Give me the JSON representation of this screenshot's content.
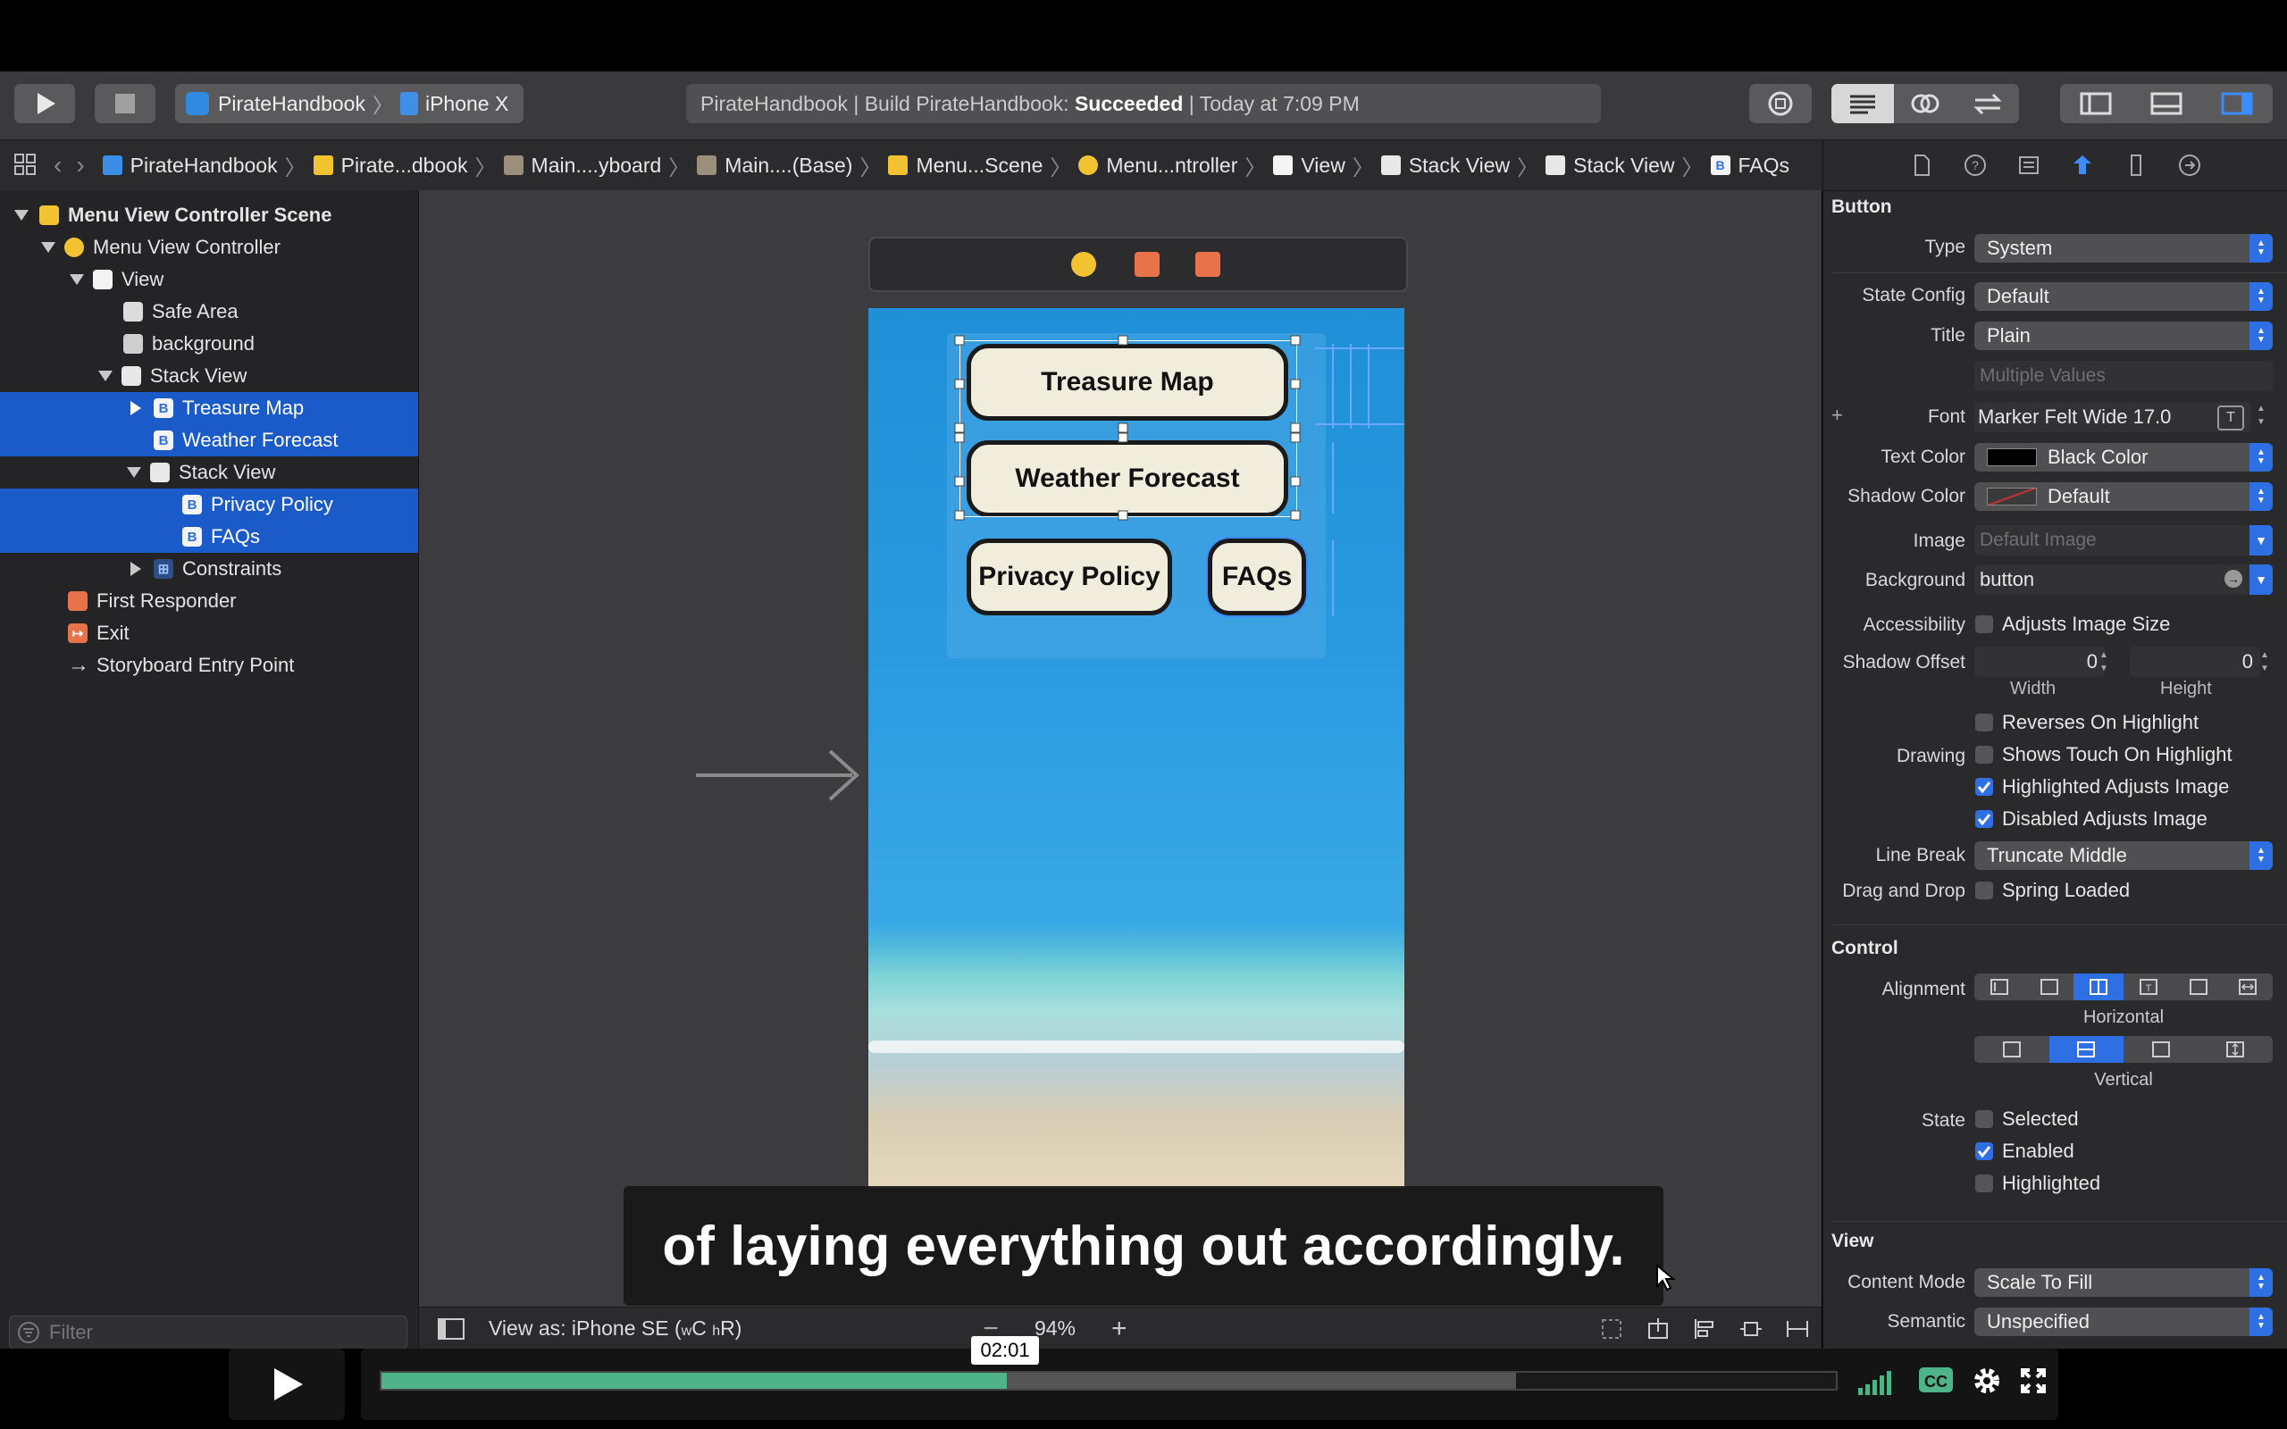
{
  "toolbar": {
    "scheme_app": "PirateHandbook",
    "scheme_device": "iPhone X",
    "status_prefix": "PirateHandbook | Build PirateHandbook: ",
    "status_result": "Succeeded",
    "status_suffix": " | Today at 7:09 PM"
  },
  "breadcrumbs": [
    "PirateHandbook",
    "Pirate...dbook",
    "Main....yboard",
    "Main....(Base)",
    "Menu...Scene",
    "Menu...ntroller",
    "View",
    "Stack View",
    "Stack View",
    "FAQs"
  ],
  "navigator": {
    "rows": [
      {
        "label": "Menu View Controller Scene",
        "icon": "scene-icon"
      },
      {
        "label": "Menu View Controller",
        "icon": "view-controller-icon"
      },
      {
        "label": "View",
        "icon": "view-icon"
      },
      {
        "label": "Safe Area",
        "icon": "safe-area-icon"
      },
      {
        "label": "background",
        "icon": "image-view-icon"
      },
      {
        "label": "Stack View",
        "icon": "stack-view-icon"
      },
      {
        "label": "Treasure Map",
        "icon": "button-icon"
      },
      {
        "label": "Weather Forecast",
        "icon": "button-icon"
      },
      {
        "label": "Stack View",
        "icon": "stack-view-icon"
      },
      {
        "label": "Privacy Policy",
        "icon": "button-icon"
      },
      {
        "label": "FAQs",
        "icon": "button-icon"
      },
      {
        "label": "Constraints",
        "icon": "constraints-icon"
      },
      {
        "label": "First Responder",
        "icon": "first-responder-icon"
      },
      {
        "label": "Exit",
        "icon": "exit-icon"
      },
      {
        "label": "Storyboard Entry Point",
        "icon": "arrow-right-icon"
      }
    ],
    "filter_placeholder": "Filter"
  },
  "canvas": {
    "buttons": [
      "Treasure Map",
      "Weather Forecast",
      "Privacy Policy",
      "FAQs"
    ],
    "view_as": "View as: iPhone SE (",
    "size_class_w": "w",
    "size_class_w_val": "C",
    "size_class_h": "h",
    "size_class_h_val": "R)",
    "zoom": "94%"
  },
  "inspector": {
    "section_button": "Button",
    "type_label": "Type",
    "type_value": "System",
    "state_config_label": "State Config",
    "state_config_value": "Default",
    "title_label": "Title",
    "title_value": "Plain",
    "title_placeholder": "Multiple Values",
    "font_label": "Font",
    "font_value": "Marker Felt Wide 17.0",
    "text_color_label": "Text Color",
    "text_color_value": "Black Color",
    "shadow_color_label": "Shadow Color",
    "shadow_color_value": "Default",
    "image_label": "Image",
    "image_placeholder": "Default Image",
    "background_label": "Background",
    "background_value": "button",
    "accessibility_label": "Accessibility",
    "adjusts_image_size": "Adjusts Image Size",
    "shadow_offset_label": "Shadow Offset",
    "shadow_offset_width": "0",
    "shadow_offset_height": "0",
    "width_label": "Width",
    "height_label": "Height",
    "reverses_on_highlight": "Reverses On Highlight",
    "drawing_label": "Drawing",
    "shows_touch": "Shows Touch On Highlight",
    "highlighted_adjusts": "Highlighted Adjusts Image",
    "disabled_adjusts": "Disabled Adjusts Image",
    "line_break_label": "Line Break",
    "line_break_value": "Truncate Middle",
    "drag_drop_label": "Drag and Drop",
    "spring_loaded": "Spring Loaded",
    "section_control": "Control",
    "alignment_label": "Alignment",
    "horizontal_label": "Horizontal",
    "vertical_label": "Vertical",
    "state_label": "State",
    "selected": "Selected",
    "enabled": "Enabled",
    "highlighted": "Highlighted",
    "section_view": "View",
    "content_mode_label": "Content Mode",
    "content_mode_value": "Scale To Fill",
    "semantic_label": "Semantic",
    "semantic_value": "Unspecified"
  },
  "caption": "of laying everything out accordingly.",
  "player": {
    "time": "02:01",
    "progress": 0.43,
    "buffered": 0.78
  },
  "colors": {
    "selection": "#1a5bc9",
    "accent": "#2f6fe4",
    "sea": "#2a9be0",
    "progress": "#4fb389"
  }
}
